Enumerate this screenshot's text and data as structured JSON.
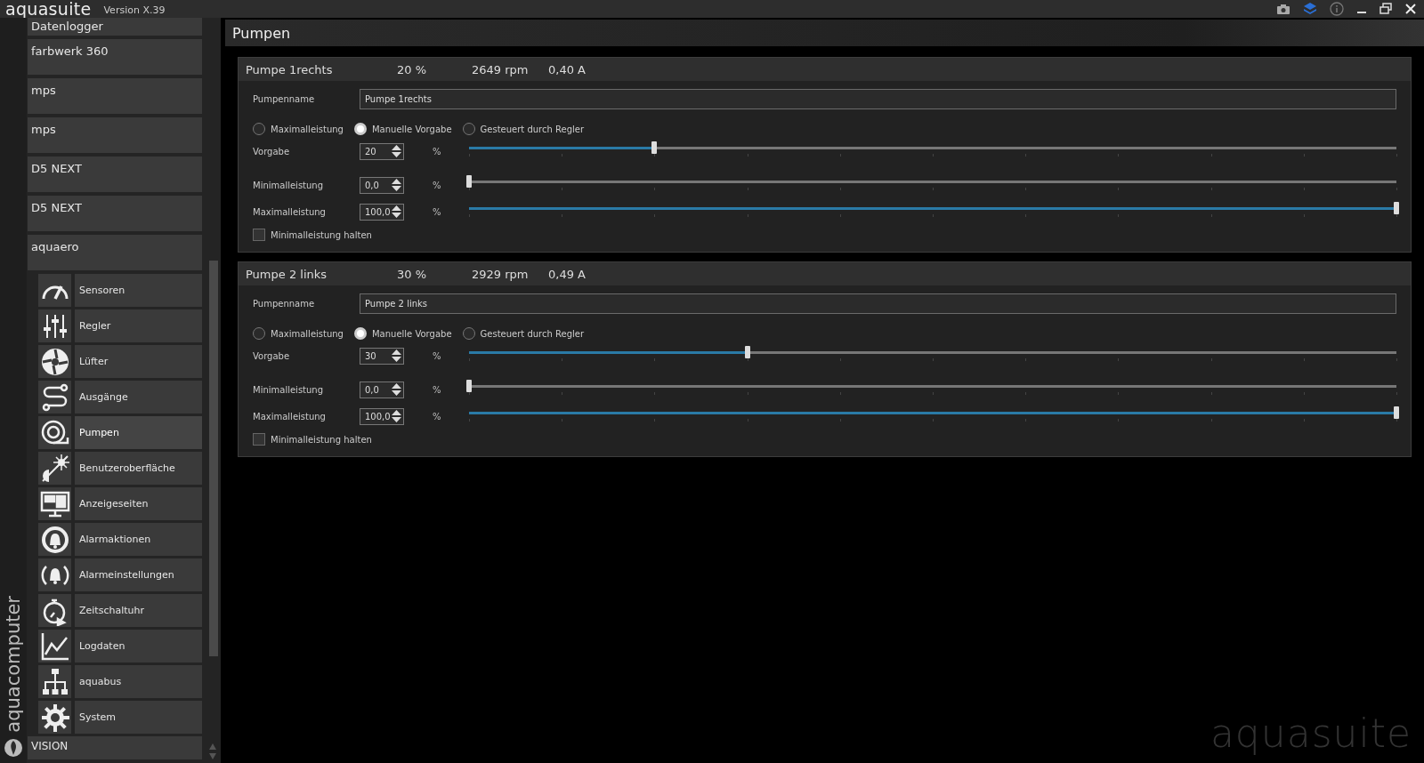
{
  "title_bar": {
    "app_name": "aquasuite",
    "version": "Version X.39"
  },
  "sidebar": {
    "brand": "aquacomputer",
    "devices": [
      {
        "label": "Datenlogger"
      },
      {
        "label": "farbwerk 360"
      },
      {
        "label": "mps"
      },
      {
        "label": "mps"
      },
      {
        "label": "D5 NEXT"
      },
      {
        "label": "D5 NEXT"
      },
      {
        "label": "aquaero"
      }
    ],
    "sections": [
      {
        "label": "Sensoren",
        "selected": false
      },
      {
        "label": "Regler",
        "selected": false
      },
      {
        "label": "Lüfter",
        "selected": false
      },
      {
        "label": "Ausgänge",
        "selected": false
      },
      {
        "label": "Pumpen",
        "selected": true
      },
      {
        "label": "Benutzeroberfläche",
        "selected": false
      },
      {
        "label": "Anzeigeseiten",
        "selected": false
      },
      {
        "label": "Alarmaktionen",
        "selected": false
      },
      {
        "label": "Alarmeinstellungen",
        "selected": false
      },
      {
        "label": "Zeitschaltuhr",
        "selected": false
      },
      {
        "label": "Logdaten",
        "selected": false
      },
      {
        "label": "aquabus",
        "selected": false
      },
      {
        "label": "System",
        "selected": false
      }
    ],
    "next_device": "VISION"
  },
  "page_title": "Pumpen",
  "pumps": [
    {
      "name": "Pumpe 1rechts",
      "power": "20 %",
      "speed": "2649 rpm",
      "current": "0,40 A",
      "name_label": "Pumpenname",
      "name_value": "Pumpe 1rechts",
      "modes": [
        {
          "label": "Maximalleistung",
          "selected": false
        },
        {
          "label": "Manuelle Vorgabe",
          "selected": true
        },
        {
          "label": "Gesteuert durch Regler",
          "selected": false
        }
      ],
      "settings": [
        {
          "label": "Vorgabe",
          "value": "20",
          "unit": "%",
          "level": 0.2
        },
        {
          "label": "Minimalleistung",
          "value": "0,0",
          "unit": "%",
          "level": 0.0
        },
        {
          "label": "Maximalleistung",
          "value": "100,0",
          "unit": "%",
          "level": 1.0
        }
      ],
      "hold": {
        "label": "Minimalleistung halten",
        "checked": false
      }
    },
    {
      "name": "Pumpe 2 links",
      "power": "30 %",
      "speed": "2929 rpm",
      "current": "0,49 A",
      "name_label": "Pumpenname",
      "name_value": "Pumpe 2 links",
      "modes": [
        {
          "label": "Maximalleistung",
          "selected": false
        },
        {
          "label": "Manuelle Vorgabe",
          "selected": true
        },
        {
          "label": "Gesteuert durch Regler",
          "selected": false
        }
      ],
      "settings": [
        {
          "label": "Vorgabe",
          "value": "30",
          "unit": "%",
          "level": 0.3
        },
        {
          "label": "Minimalleistung",
          "value": "0,0",
          "unit": "%",
          "level": 0.0
        },
        {
          "label": "Maximalleistung",
          "value": "100,0",
          "unit": "%",
          "level": 1.0
        }
      ],
      "hold": {
        "label": "Minimalleistung halten",
        "checked": false
      }
    }
  ],
  "background_logo": "aquasuite"
}
